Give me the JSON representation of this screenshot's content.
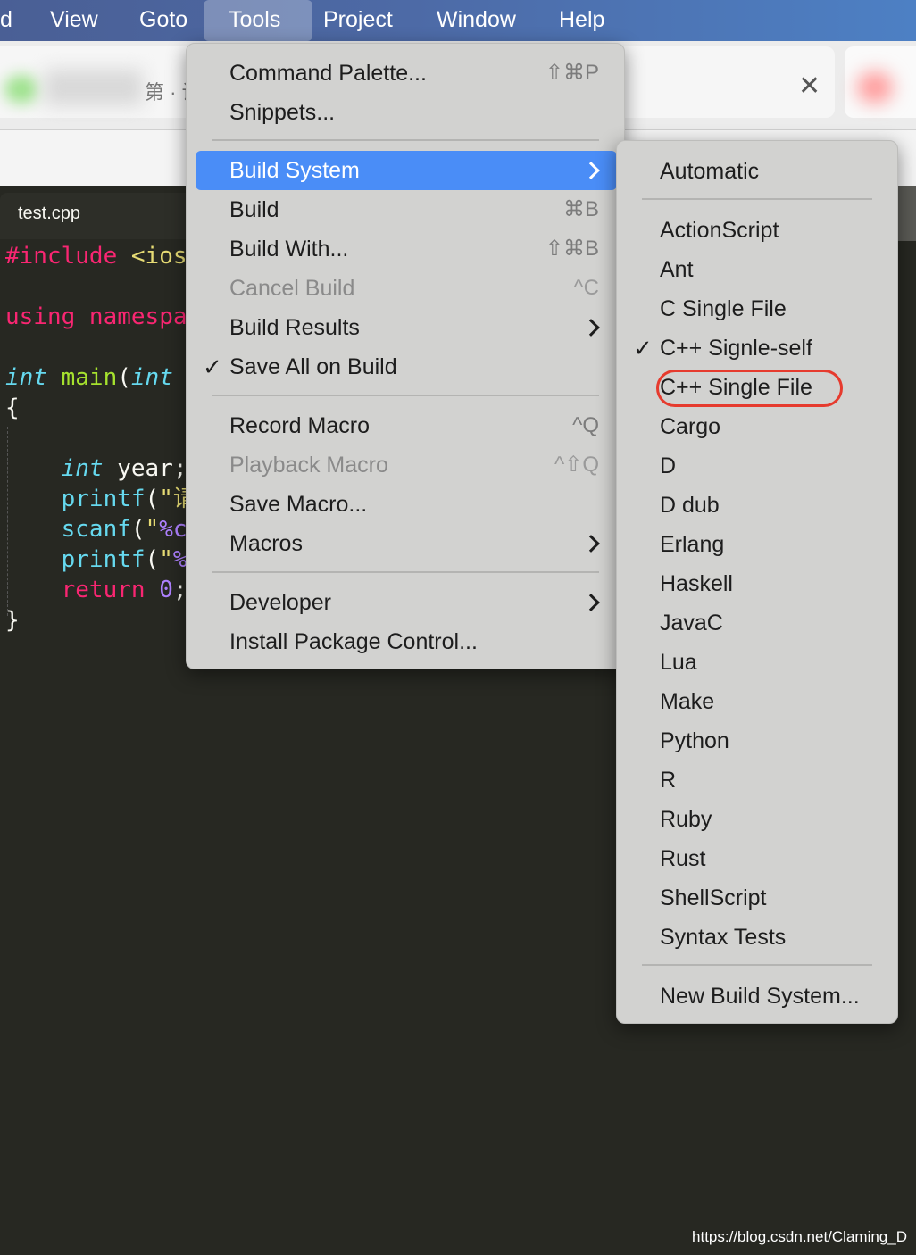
{
  "menubar": {
    "items": [
      "d",
      "View",
      "Goto",
      "Tools",
      "Project",
      "Window",
      "Help"
    ]
  },
  "browser": {
    "tab_fragment": "第 · 试",
    "close_glyph": "✕"
  },
  "editor": {
    "file_tab": "test.cpp",
    "lines": {
      "include_kw": "#include",
      "include_rest": " <ios",
      "using_kw": "using",
      "namespace": " namespa",
      "int1": "int",
      "main": " main",
      "paren": "(",
      "int2": "int",
      "brace_open": "{",
      "int3": "int",
      "year": " year;",
      "printf1": "printf",
      "p1_paren": "(",
      "p1_str": "\"请",
      "scanf": "scanf",
      "s_paren": "(",
      "s_q": "\"",
      "s_fmt": "%c",
      "printf2": "printf",
      "p2_paren": "(",
      "p2_str": "\"",
      "p2_fmt": "%",
      "return": "return",
      "zero": " 0",
      "semi": ";",
      "brace_close": "}"
    }
  },
  "tools_menu": {
    "items": [
      {
        "label": "Command Palette...",
        "shortcut": "⇧⌘P"
      },
      {
        "label": "Snippets..."
      },
      {
        "label": "Build System",
        "submenu": true,
        "highlighted": true
      },
      {
        "label": "Build",
        "shortcut": "⌘B"
      },
      {
        "label": "Build With...",
        "shortcut": "⇧⌘B"
      },
      {
        "label": "Cancel Build",
        "shortcut": "^C",
        "disabled": true
      },
      {
        "label": "Build Results",
        "submenu": true
      },
      {
        "label": "Save All on Build",
        "checked": true
      },
      {
        "label": "Record Macro",
        "shortcut": "^Q"
      },
      {
        "label": "Playback Macro",
        "shortcut": "^⇧Q",
        "disabled": true
      },
      {
        "label": "Save Macro..."
      },
      {
        "label": "Macros",
        "submenu": true
      },
      {
        "label": "Developer",
        "submenu": true
      },
      {
        "label": "Install Package Control..."
      }
    ]
  },
  "build_system_menu": {
    "items": [
      "Automatic",
      "ActionScript",
      "Ant",
      "C Single File",
      "C++ Signle-self",
      "C++ Single File",
      "Cargo",
      "D",
      "D dub",
      "Erlang",
      "Haskell",
      "JavaC",
      "Lua",
      "Make",
      "Python",
      "R",
      "Ruby",
      "Rust",
      "ShellScript",
      "Syntax Tests",
      "New Build System..."
    ],
    "checked_item": "C++ Signle-self",
    "annotated_item": "C++ Single File"
  },
  "colors": {
    "menu_highlight": "#4a8df7",
    "annotation": "#e63b2e",
    "editor_bg": "#272822"
  },
  "watermark": "https://blog.csdn.net/Claming_D"
}
